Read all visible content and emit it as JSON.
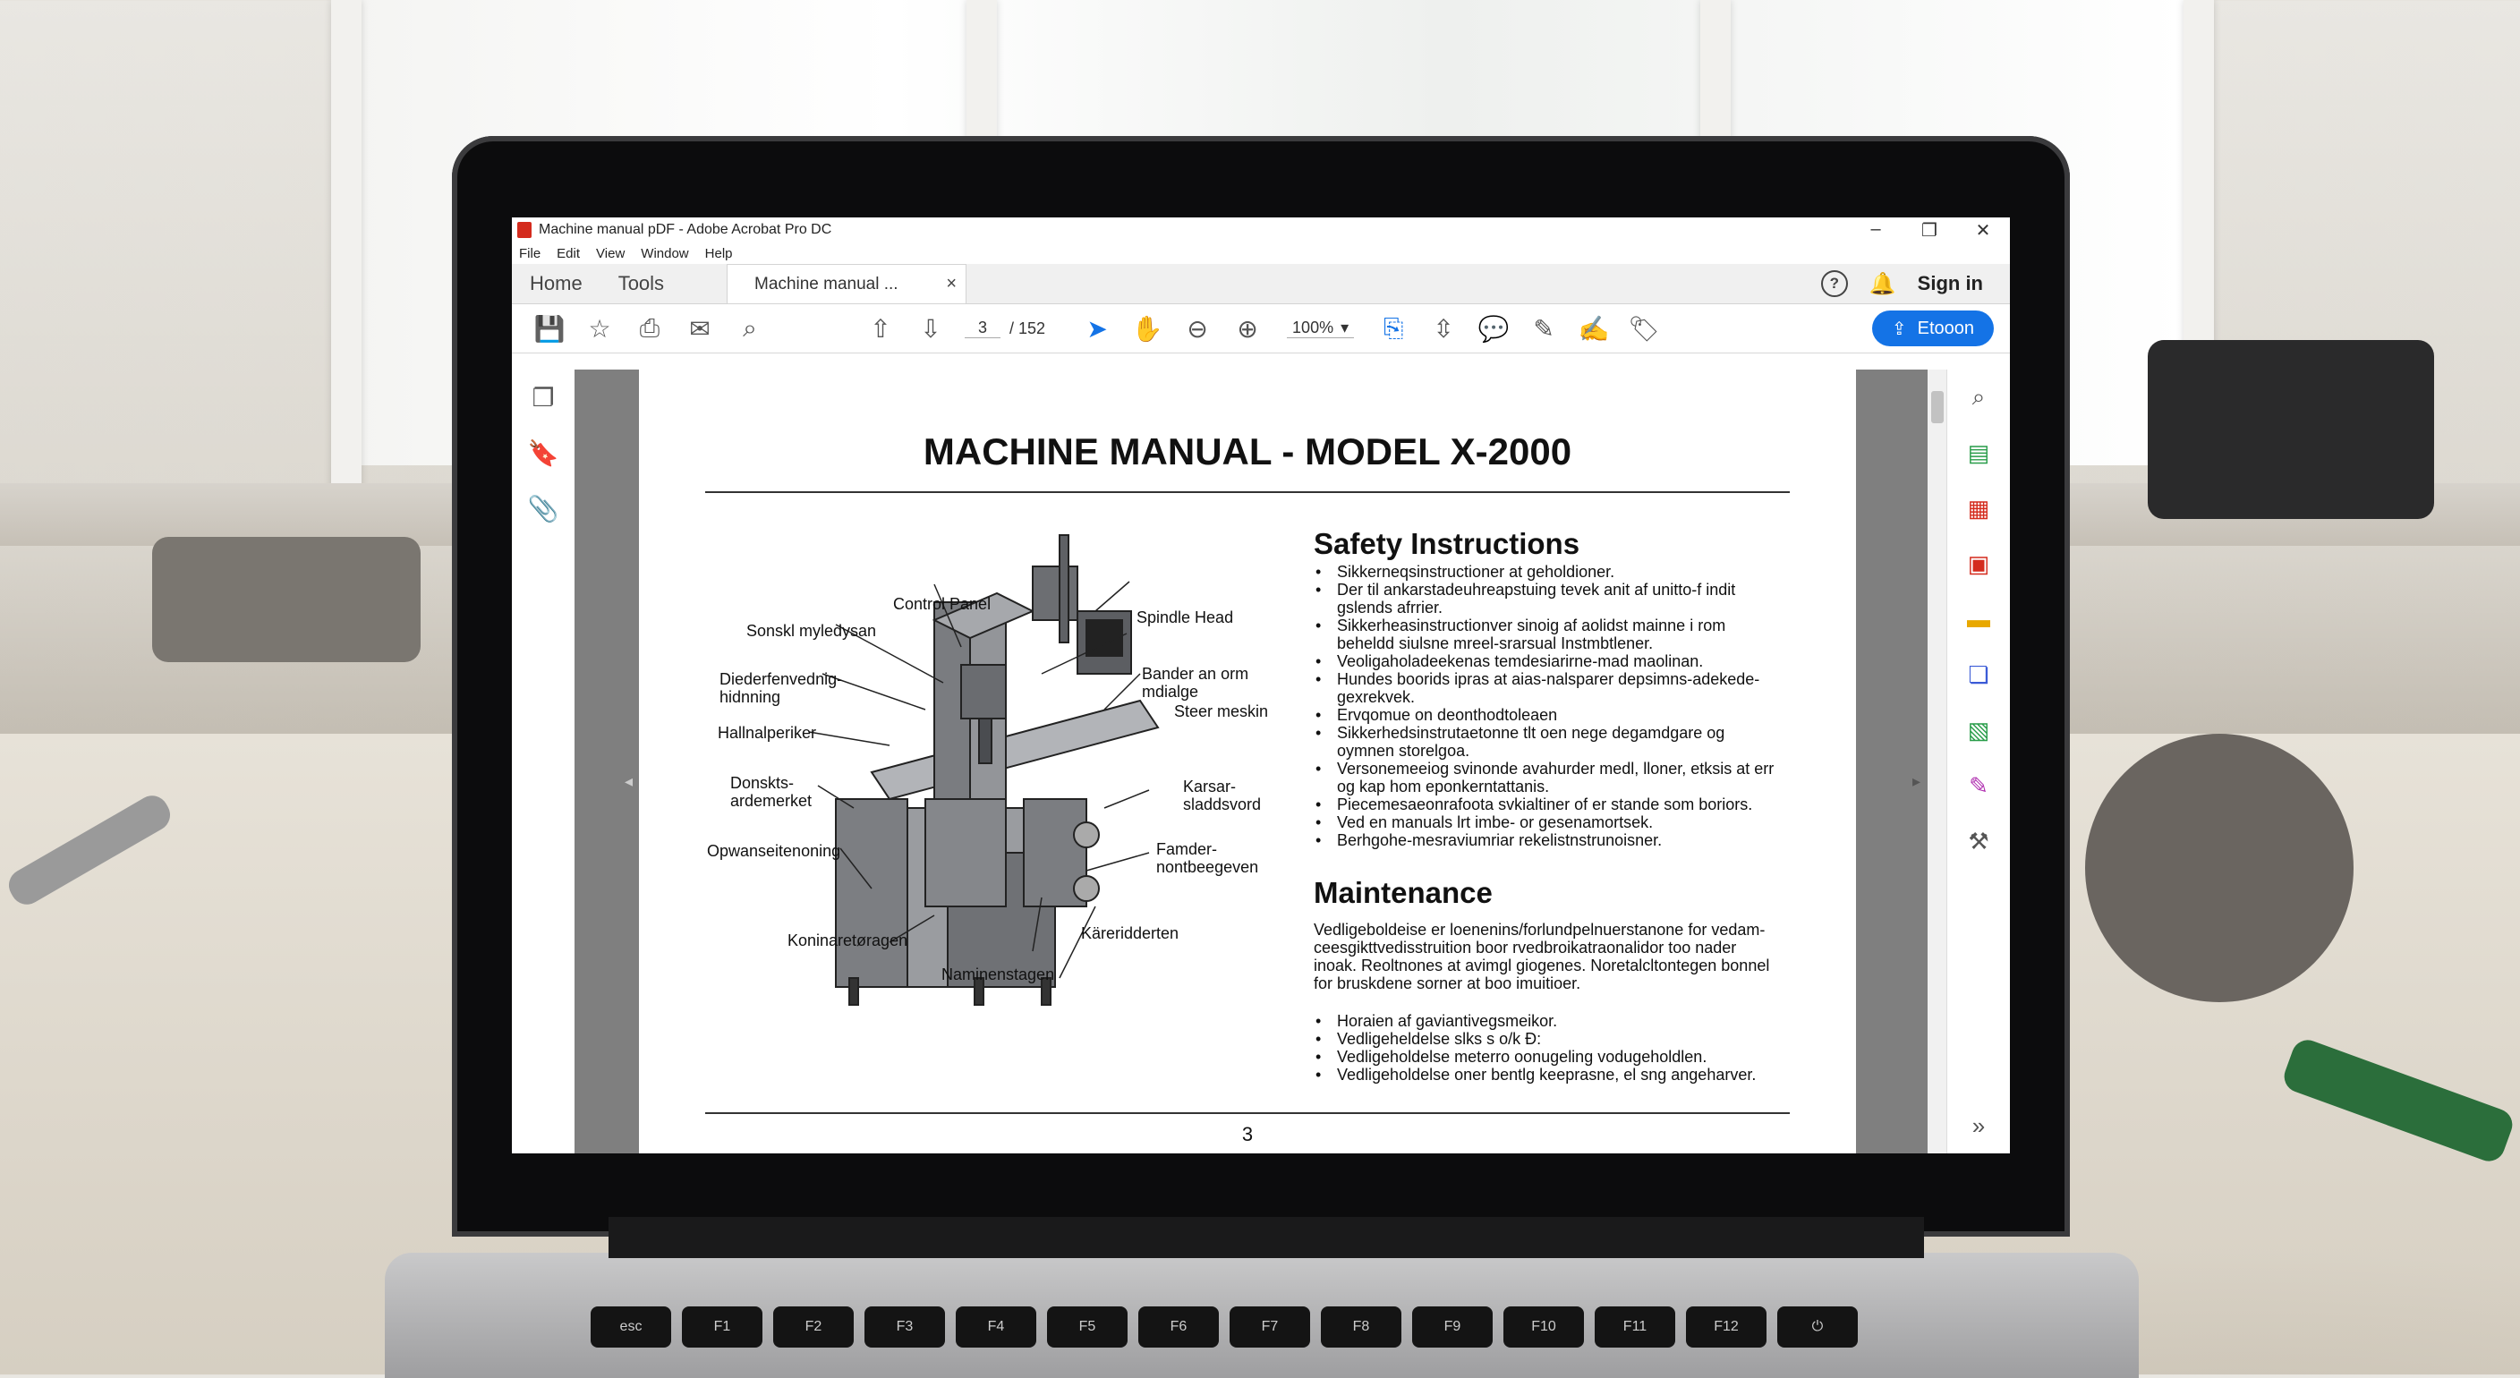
{
  "window": {
    "title": "Machine manual pDF - Adobe Acrobat Pro DC",
    "controls": {
      "minimize": "–",
      "restore": "❐",
      "close": "✕"
    }
  },
  "menu": [
    "File",
    "Edit",
    "View",
    "Window",
    "Help"
  ],
  "tabs": {
    "home": "Home",
    "tools": "Tools",
    "document": "Machine manual ...",
    "close": "×"
  },
  "header_right": {
    "help": "?",
    "sign_in": "Sign in"
  },
  "toolbar": {
    "page_current": "3",
    "page_total": "/ 152",
    "zoom": "100%",
    "share_label": "Etooon"
  },
  "document": {
    "title": "MACHINE MANUAL - MODEL X-2000",
    "safety": {
      "heading": "Safety Instructions",
      "items": [
        "Sikkerneqsinstructioner at geholdioner.",
        "Der til ankarstadeuhreapstuing tevek anit af unitto-f indit gslends afrrier.",
        "Sikkerheasinstructionver sinoig af aolidst mainne i rom beheldd siulsne mreel-srarsual Instmbtlener.",
        "Veoligaholadeekenas temdesiarirne-mad maolinan.",
        "Hundes boorids ipras at aias-nalsparer depsimns-adekede-gexrekvek.",
        "Ervqomue on deonthodtoleaen",
        "Sikkerhedsinstrutaetonne tlt oen nege degamdgare og oymnen storelgoa.",
        "Versonemeeiog svinonde avahurder medl, lloner, etksis at err og kap hom eponkerntattanis.",
        "Piecemesaeonrafoota svkialtiner of er stande som boriors.",
        "Ved en manuals lrt imbe- or gesenamortsek.",
        "Berhgohe-mesraviumriar rekelistnstrunoisner."
      ]
    },
    "maintenance": {
      "heading": "Maintenance",
      "paragraph": "Vedligeboldeise er loenenins/forlundpelnuerstanone for vedam-ceesgikttvedisstruition boor rvedbroikatraonalidor too nader inoak. Reoltnones at avimgl giogenes. Noretalcltontegen bonnel for bruskdene sorner at boo imuitioer.",
      "items": [
        "Horaien af gaviantivegsmeikor.",
        "Vedligeheldelse slks s o/k Ð:",
        "Vedligeholdelse meterro oonugeling vodugeholdlen.",
        "Vedligeholdelse oner bentlg keeprasne, el sng angeharver."
      ]
    },
    "diagram_labels": {
      "control_panel": "Control Panel",
      "spindle_head": "Spindle Head",
      "sonski": "Sonskl myledysan",
      "banden": "Bander an orm mdialge",
      "dieder": "Diederfenvednig-\nhidnning",
      "steer": "Steer meskin",
      "hallnal": "Hallnalperiker",
      "donsk": "Donskts-\nardemerket",
      "karsar": "Karsar-\nsladdsvord",
      "opwan": "Opwanseitenoning",
      "famder": "Famder-\nnontbeegeven",
      "konina": "Koninaretøragen",
      "kareid": "Käreridderten",
      "namin": "Naminenstagen"
    },
    "page_number": "3"
  },
  "keyboard": [
    "esc",
    "F1",
    "F2",
    "F3",
    "F4",
    "F5",
    "F6",
    "F7",
    "F8",
    "F9",
    "F10",
    "F11",
    "F12",
    "⏻"
  ],
  "colors": {
    "accent": "#1473e6",
    "acrobat_red": "#d42b1d"
  }
}
